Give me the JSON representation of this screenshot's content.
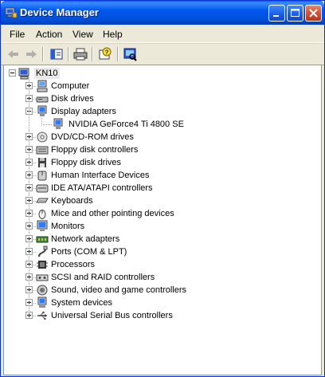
{
  "window": {
    "title": "Device Manager"
  },
  "menu": [
    "File",
    "Action",
    "View",
    "Help"
  ],
  "tree": {
    "root": "KN10",
    "categories": [
      {
        "label": "Computer",
        "icon": "computer-icon",
        "expanded": false
      },
      {
        "label": "Disk drives",
        "icon": "disk-drive-icon",
        "expanded": false
      },
      {
        "label": "Display adapters",
        "icon": "display-adapter-icon",
        "expanded": true,
        "children": [
          "NVIDIA GeForce4 Ti 4800 SE"
        ]
      },
      {
        "label": "DVD/CD-ROM drives",
        "icon": "cd-rom-icon",
        "expanded": false
      },
      {
        "label": "Floppy disk controllers",
        "icon": "floppy-controller-icon",
        "expanded": false
      },
      {
        "label": "Floppy disk drives",
        "icon": "floppy-drive-icon",
        "expanded": false
      },
      {
        "label": "Human Interface Devices",
        "icon": "hid-icon",
        "expanded": false
      },
      {
        "label": "IDE ATA/ATAPI controllers",
        "icon": "ide-controller-icon",
        "expanded": false
      },
      {
        "label": "Keyboards",
        "icon": "keyboard-icon",
        "expanded": false
      },
      {
        "label": "Mice and other pointing devices",
        "icon": "mouse-icon",
        "expanded": false
      },
      {
        "label": "Monitors",
        "icon": "monitor-icon",
        "expanded": false
      },
      {
        "label": "Network adapters",
        "icon": "network-adapter-icon",
        "expanded": false
      },
      {
        "label": "Ports (COM & LPT)",
        "icon": "port-icon",
        "expanded": false
      },
      {
        "label": "Processors",
        "icon": "processor-icon",
        "expanded": false
      },
      {
        "label": "SCSI and RAID controllers",
        "icon": "scsi-icon",
        "expanded": false
      },
      {
        "label": "Sound, video and game controllers",
        "icon": "sound-icon",
        "expanded": false
      },
      {
        "label": "System devices",
        "icon": "system-device-icon",
        "expanded": false
      },
      {
        "label": "Universal Serial Bus controllers",
        "icon": "usb-icon",
        "expanded": false
      }
    ]
  }
}
